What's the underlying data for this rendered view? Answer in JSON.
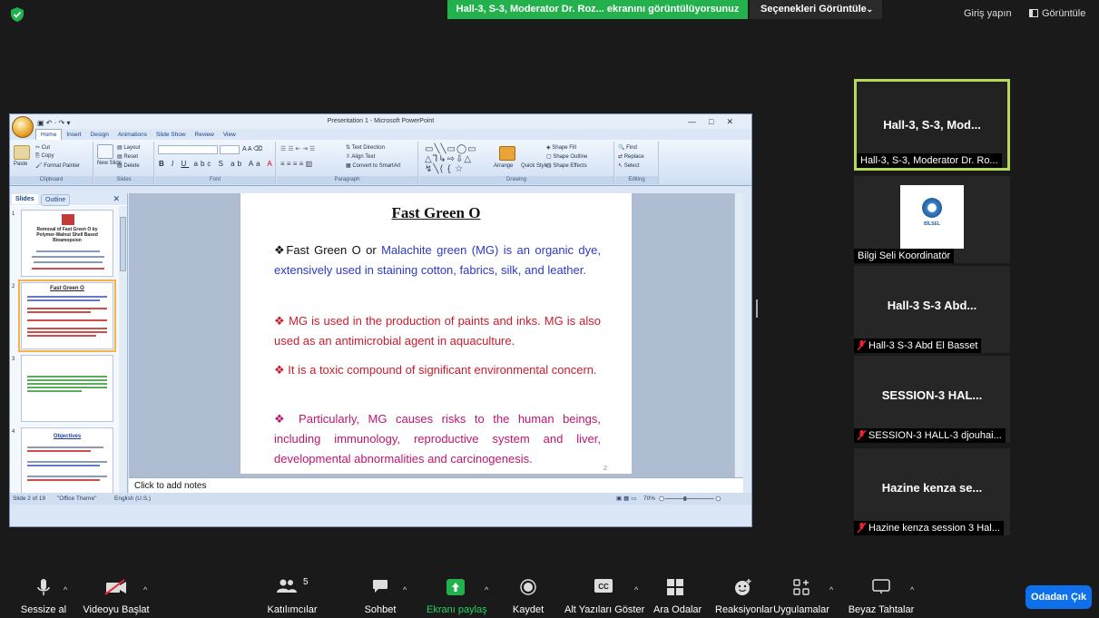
{
  "top": {
    "share_banner": "Hall-3, S-3, Moderator Dr. Roz... ekranını görüntülüyorsunuz",
    "options_label": "Seçenekleri Görüntüle",
    "signin": "Giriş yapın",
    "view": "Görüntüle"
  },
  "ppt": {
    "window_title": "Presentation 1 - Microsoft PowerPoint",
    "tabs": [
      "Home",
      "Insert",
      "Design",
      "Animations",
      "Slide Show",
      "Review",
      "View"
    ],
    "clipboard": {
      "cut": "Cut",
      "copy": "Copy",
      "paste": "Paste",
      "format_painter": "Format Painter",
      "label": "Clipboard"
    },
    "slides_group": {
      "layout": "Layout",
      "reset": "Reset",
      "new_slide": "New Slide",
      "delete": "Delete",
      "label": "Slides"
    },
    "font_group": {
      "label": "Font"
    },
    "paragraph_group": {
      "text_direction": "Text Direction",
      "align_text": "Align Text",
      "convert_smartart": "Convert to SmartArt",
      "label": "Paragraph"
    },
    "drawing_group": {
      "arrange": "Arrange",
      "quick_styles": "Quick Styles",
      "shape_fill": "Shape Fill",
      "shape_outline": "Shape Outline",
      "shape_effects": "Shape Effects",
      "label": "Drawing"
    },
    "editing_group": {
      "find": "Find",
      "replace": "Replace",
      "select": "Select",
      "label": "Editing"
    },
    "pane_tabs": {
      "slides": "Slides",
      "outline": "Outline"
    },
    "thumbnails": [
      {
        "num": "1",
        "title": "Removal of Fast Green O by Polymer-Walnut Shell Based Bioamopsion"
      },
      {
        "num": "2",
        "title": "Fast Green O"
      },
      {
        "num": "3",
        "title": ""
      },
      {
        "num": "4",
        "title": "Objectives"
      }
    ],
    "slide": {
      "title": "Fast Green O",
      "p1_a": "❖Fast Green O or ",
      "p1_b": "Malachite green (MG) is an organic dye, extensively used in staining cotton, fabrics, silk, and leather.",
      "p2": "❖ MG is used in the production of paints and inks. MG is also used as an antimicrobial agent in aquaculture.",
      "p3": "❖ It is a toxic compound of significant environmental concern.",
      "p4": "❖ Particularly, MG causes risks to the human beings, including immunology, reproductive system and liver, developmental abnormalities and carcinogenesis.",
      "page_number": "2"
    },
    "notes_placeholder": "Click to add notes",
    "status": {
      "slide": "Slide 2 of 19",
      "theme": "\"Office Theme\"",
      "language": "English (U.S.)",
      "zoom": "70%"
    }
  },
  "participants": [
    {
      "main": "Hall-3, S-3, Mod...",
      "caption": "Hall-3, S-3, Moderator Dr. Ro...",
      "muted": false,
      "active": true
    },
    {
      "main": "",
      "caption": "Bilgi Seli Koordinatör",
      "muted": false,
      "active": false,
      "logo_text": "BİLSEL"
    },
    {
      "main": "Hall-3   S-3  Abd...",
      "caption": "Hall-3   S-3 Abd El Basset",
      "muted": true,
      "active": false
    },
    {
      "main": "SESSION-3  HAL...",
      "caption": "SESSION-3 HALL-3 djouhai...",
      "muted": true,
      "active": false
    },
    {
      "main": "Hazine  kenza  se...",
      "caption": "Hazine kenza session 3 Hal...",
      "muted": true,
      "active": false
    }
  ],
  "toolbar": {
    "mute": "Sessize al",
    "video": "Videoyu Başlat",
    "participants": "Katılımcılar",
    "participants_count": "5",
    "chat": "Sohbet",
    "share": "Ekranı paylaş",
    "record": "Kaydet",
    "captions": "Alt Yazıları Göster",
    "breakout": "Ara Odalar",
    "reactions": "Reaksiyonlar",
    "apps": "Uygulamalar",
    "whiteboard": "Beyaz Tahtalar",
    "leave": "Odadan Çık"
  },
  "colors": {
    "share_green": "#23b14d",
    "leave_blue": "#0e71eb",
    "active_border": "#b6d95c"
  }
}
